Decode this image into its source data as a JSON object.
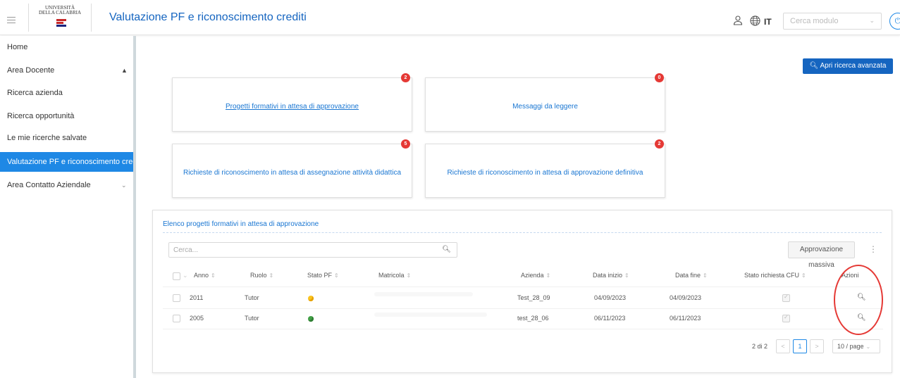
{
  "header": {
    "logo_text": "UNIVERSITÀ DELLA CALABRIA",
    "title": "Valutazione PF e riconoscimento crediti",
    "language": "IT",
    "module_search_placeholder": "Cerca modulo",
    "icons": [
      "menu-icon",
      "user-icon",
      "globe-icon",
      "chevron-down-icon",
      "power-icon"
    ]
  },
  "sidebar": {
    "items": [
      {
        "label": "Home"
      },
      {
        "label": "Area Docente",
        "expanded": true
      },
      {
        "label": "Ricerca azienda"
      },
      {
        "label": "Ricerca opportunità"
      },
      {
        "label": "Le mie ricerche salvate"
      },
      {
        "label": "Valutazione PF e riconoscimento crediti",
        "active": true
      },
      {
        "label": "Area Contatto Aziendale",
        "expanded": false
      }
    ],
    "accent_color": "#1e88e5"
  },
  "main": {
    "advanced_search_label": "Apri ricerca avanzata",
    "cards": [
      {
        "label": "Progetti formativi in attesa di approvazione",
        "count": "2"
      },
      {
        "label": "Messaggi da leggere",
        "count": "0"
      },
      {
        "label": "Richieste di riconoscimento in attesa di assegnazione attività didattica",
        "count": "5"
      },
      {
        "label": "Richieste di riconoscimento in attesa di approvazione definitiva",
        "count": "2"
      }
    ],
    "list": {
      "title": "Elenco progetti formativi in attesa di approvazione",
      "search_placeholder": "Cerca...",
      "mass_approval_label": "Approvazione massiva",
      "columns": [
        "Anno",
        "Ruolo",
        "Stato PF",
        "Matricola",
        "Azienda",
        "Data inizio",
        "Data fine",
        "Stato richiesta CFU",
        "Azioni"
      ],
      "rows": [
        {
          "anno": "2011",
          "ruolo": "Tutor",
          "stato_pf": "yellow",
          "azienda": "Test_28_09",
          "data_inizio": "04/09/2023",
          "data_fine": "04/09/2023"
        },
        {
          "anno": "2005",
          "ruolo": "Tutor",
          "stato_pf": "green",
          "azienda": "test_28_06",
          "data_inizio": "06/11/2023",
          "data_fine": "06/11/2023"
        }
      ],
      "pagination": {
        "total": "2 di 2",
        "current_page": "1",
        "page_size": "10 / page"
      }
    }
  },
  "colors": {
    "primary": "#1565c0",
    "link": "#1976d2",
    "badge": "#e53935",
    "status_yellow": "#f9c31f",
    "status_green": "#43a047"
  }
}
